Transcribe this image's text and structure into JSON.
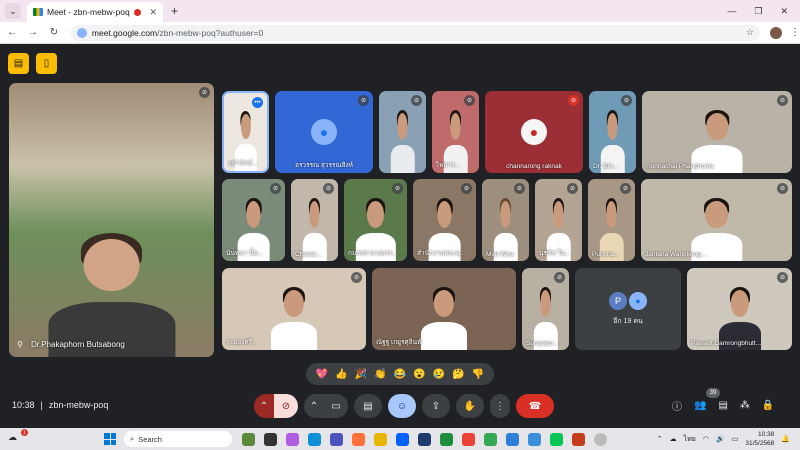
{
  "browser": {
    "tab_title": "Meet - zbn-mebw-poq",
    "url_host": "meet.google.com",
    "url_path": "/zbn-mebw-poq?authuser=0"
  },
  "meeting": {
    "time": "10:38",
    "separator": "|",
    "code": "zbn-mebw-poq",
    "participant_count": "39"
  },
  "main_speaker": {
    "name": "Dr.Phakaphorn Butsabong"
  },
  "participants": [
    {
      "name": "จุฬาลักษ์..."
    },
    {
      "name": "อรวรรณ สุวรรณสิงห์"
    },
    {
      "name": ""
    },
    {
      "name": "ไพสาร..."
    },
    {
      "name": "channarong raknak"
    },
    {
      "name": "Dr. Ekr..."
    },
    {
      "name": "Ronnachai Phanphonla"
    },
    {
      "name": "นันทนา นิ้ม..."
    },
    {
      "name": "Chanat..."
    },
    {
      "name": "กมลพร พวงพรร..."
    },
    {
      "name": "สำนักงานพระพุ..."
    },
    {
      "name": "Mint Wira"
    },
    {
      "name": "นุชรัช ใน..."
    },
    {
      "name": "Puncha..."
    },
    {
      "name": "Jantana Wangkong..."
    },
    {
      "name": "ละอองศรี..."
    },
    {
      "name": "ณัฐฐ เกยูรศุลินท์"
    },
    {
      "name": "Suniyapo..."
    },
    {
      "name": "Pawarit Damrongbhutt..."
    }
  ],
  "group_tile": {
    "initial": "P",
    "more_label": "อีก 19 คน"
  },
  "reactions": [
    "💖",
    "👍",
    "🎉",
    "👏",
    "😂",
    "😮",
    "😢",
    "🤔",
    "👎"
  ],
  "taskbar": {
    "search_placeholder": "Search",
    "weather_badge": "1",
    "lang": "ไทย",
    "clock_time": "10:38",
    "clock_date": "31/5/2568"
  }
}
